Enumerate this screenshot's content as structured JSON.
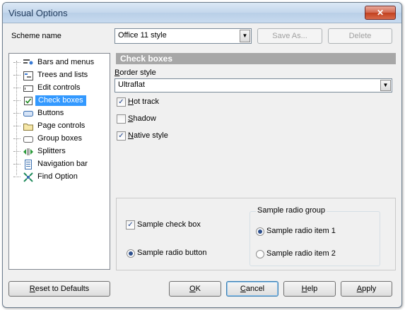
{
  "window": {
    "title": "Visual Options"
  },
  "scheme": {
    "label": "Scheme name",
    "value": "Office 11 style",
    "save_as": "Save As...",
    "delete": "Delete"
  },
  "tree": {
    "items": [
      {
        "label": "Bars and menus",
        "icon": "bars-menus-icon"
      },
      {
        "label": "Trees and lists",
        "icon": "trees-lists-icon"
      },
      {
        "label": "Edit controls",
        "icon": "edit-controls-icon"
      },
      {
        "label": "Check boxes",
        "icon": "check-box-icon",
        "selected": true
      },
      {
        "label": "Buttons",
        "icon": "button-icon"
      },
      {
        "label": "Page controls",
        "icon": "folder-tab-icon"
      },
      {
        "label": "Group boxes",
        "icon": "group-box-icon"
      },
      {
        "label": "Splitters",
        "icon": "splitter-icon"
      },
      {
        "label": "Navigation bar",
        "icon": "navigation-bar-icon"
      },
      {
        "label": "Find Option",
        "icon": "find-option-icon"
      }
    ]
  },
  "section": {
    "title": "Check boxes"
  },
  "border_style": {
    "label_u": "B",
    "label_rest": "order style",
    "value": "Ultraflat"
  },
  "options": {
    "hot_track": {
      "u": "H",
      "rest": "ot track",
      "checked": true
    },
    "shadow": {
      "u": "S",
      "rest": "hadow",
      "checked": false
    },
    "native_style": {
      "u": "N",
      "rest": "ative style",
      "checked": true
    }
  },
  "sample": {
    "check_box": "Sample check box",
    "radio_button": "Sample radio button",
    "group_title": "Sample radio group",
    "radio_item_1": "Sample radio item 1",
    "radio_item_2": "Sample radio item 2"
  },
  "buttons": {
    "reset_u": "R",
    "reset_rest": "eset to Defaults",
    "ok_u": "O",
    "ok_rest": "K",
    "cancel_u": "C",
    "cancel_rest": "ancel",
    "help_u": "H",
    "help_rest": "elp",
    "apply_u": "A",
    "apply_rest": "pply"
  },
  "colors": {
    "selection": "#3399ff",
    "section_header": "#a7a7a7"
  }
}
